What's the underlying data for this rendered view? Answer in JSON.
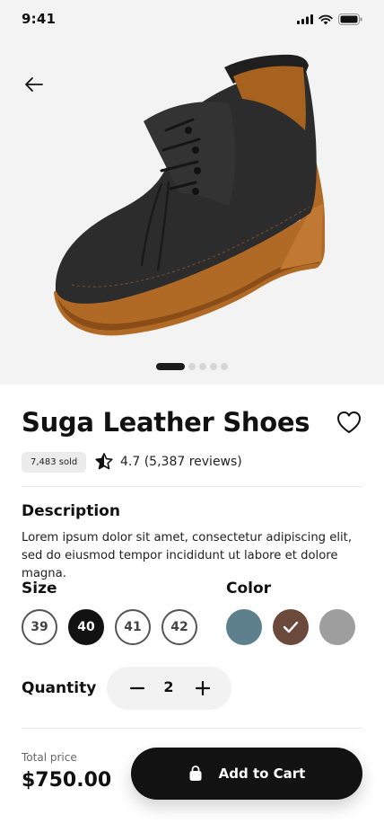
{
  "status_bar": {
    "time": "9:41"
  },
  "product": {
    "title": "Suga Leather Shoes",
    "sold": "7,483 sold",
    "rating": "4.7 (5,387 reviews)",
    "image_dots": {
      "count": 5,
      "active_index": 0
    }
  },
  "description": {
    "heading": "Description",
    "text": "Lorem ipsum dolor sit amet, consectetur adipiscing elit, sed do eiusmod tempor incididunt ut labore et dolore magna."
  },
  "size": {
    "heading": "Size",
    "options": [
      "39",
      "40",
      "41",
      "42"
    ],
    "selected": "40"
  },
  "color": {
    "heading": "Color",
    "options": [
      "#5e7f8c",
      "#6b4a3c",
      "#9e9e9e"
    ],
    "selected_index": 1
  },
  "quantity": {
    "label": "Quantity",
    "value": "2"
  },
  "checkout": {
    "total_label": "Total price",
    "total_price": "$750.00",
    "button_label": "Add to Cart"
  },
  "icons": [
    "signal-icon",
    "wifi-icon",
    "battery-icon",
    "back-arrow-icon",
    "heart-icon",
    "star-half-icon",
    "minus-icon",
    "plus-icon",
    "bag-icon",
    "check-icon"
  ]
}
